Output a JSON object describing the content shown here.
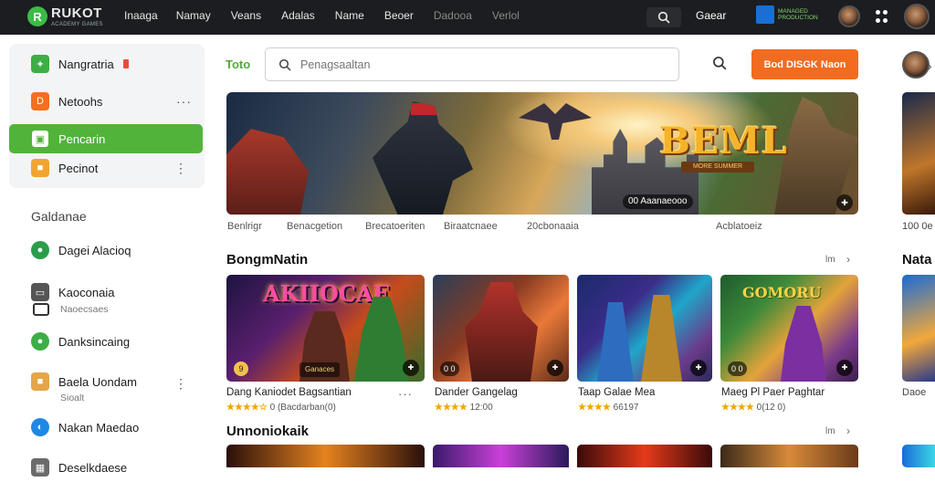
{
  "topbar": {
    "logo_text": "RUKOT",
    "logo_sub": "ACADEMY GAMES",
    "nav": [
      "Inaaga",
      "Namay",
      "Veans",
      "Adalas",
      "Name",
      "Beoer",
      "Dadooa",
      "Verlol"
    ],
    "right_label": "Gaear",
    "brand_badge": "MANAGED PRODUCTION"
  },
  "sidebar": {
    "items": [
      {
        "label": "Nangratria",
        "icon": "leaf-icon",
        "color": "#3cae45"
      },
      {
        "label": "Netoohs",
        "icon": "document-icon",
        "color": "#f37021"
      },
      {
        "label": "Pencarin",
        "icon": "image-icon",
        "color": "#ffffff"
      },
      {
        "label": "Pecinot",
        "icon": "box-icon",
        "color": "#f0a530"
      }
    ],
    "section_heading": "Galdanae",
    "links": [
      {
        "label": "Dagei Alacioq",
        "sub": "",
        "icon": "globe-icon",
        "color": "#2a9d4b"
      },
      {
        "label": "Kaoconaia",
        "sub": "Naoecsaes",
        "icon": "monitor-icon",
        "color": "#555555"
      },
      {
        "label": "Danksincaing",
        "sub": "",
        "icon": "chat-icon",
        "color": "#3cae45"
      },
      {
        "label": "Baela Uondam",
        "sub": "Sioalt",
        "icon": "package-icon",
        "color": "#e5a64a"
      },
      {
        "label": "Nakan Maedao",
        "sub": "",
        "icon": "planet-icon",
        "color": "#1e88e5"
      },
      {
        "label": "Deselkdaese",
        "sub": "",
        "icon": "store-icon",
        "color": "#6b6b6b"
      }
    ]
  },
  "main": {
    "tab_label": "Toto",
    "search_placeholder": "Penagsaaltan",
    "cta_label": "Bod DISGK Naon",
    "hero": {
      "title": "BEML",
      "title_sub": "MORE SUMMER",
      "badge": "00 Aaanaeooo",
      "meta": [
        "Benlrigr",
        "Benacgetion",
        "Brecatoeriten",
        "Biraatcnaee",
        "20cbonaaia",
        "Acblatoeiz"
      ]
    },
    "sections": [
      {
        "title": "BongmNatin",
        "more": "lm"
      },
      {
        "title": "Unnoniokaik",
        "more": "lm"
      }
    ],
    "cards": [
      {
        "title_art": "AKIIOCAE",
        "pill": "Ganaces",
        "name": "Dang Kaniodet Bagsantian",
        "rating": "★★★★☆",
        "count": "0 (Bacdarban(0)",
        "badge": "9"
      },
      {
        "title_art": "",
        "pill": "",
        "name": "Dander Gangelag",
        "rating": "★★★★",
        "count": "12:00",
        "badge": "0 0"
      },
      {
        "title_art": "",
        "pill": "",
        "name": "Taap Galae Mea",
        "rating": "★★★★",
        "count": "66197",
        "badge": ""
      },
      {
        "title_art": "GOMORU",
        "pill": "",
        "name": "Maeg Pl Paer Paghtar",
        "rating": "★★★★",
        "count": "0(12 0)",
        "badge": "0 0"
      }
    ],
    "peek": {
      "label": "Nata",
      "caption": "Daoe",
      "caption2": "100 0e"
    }
  }
}
